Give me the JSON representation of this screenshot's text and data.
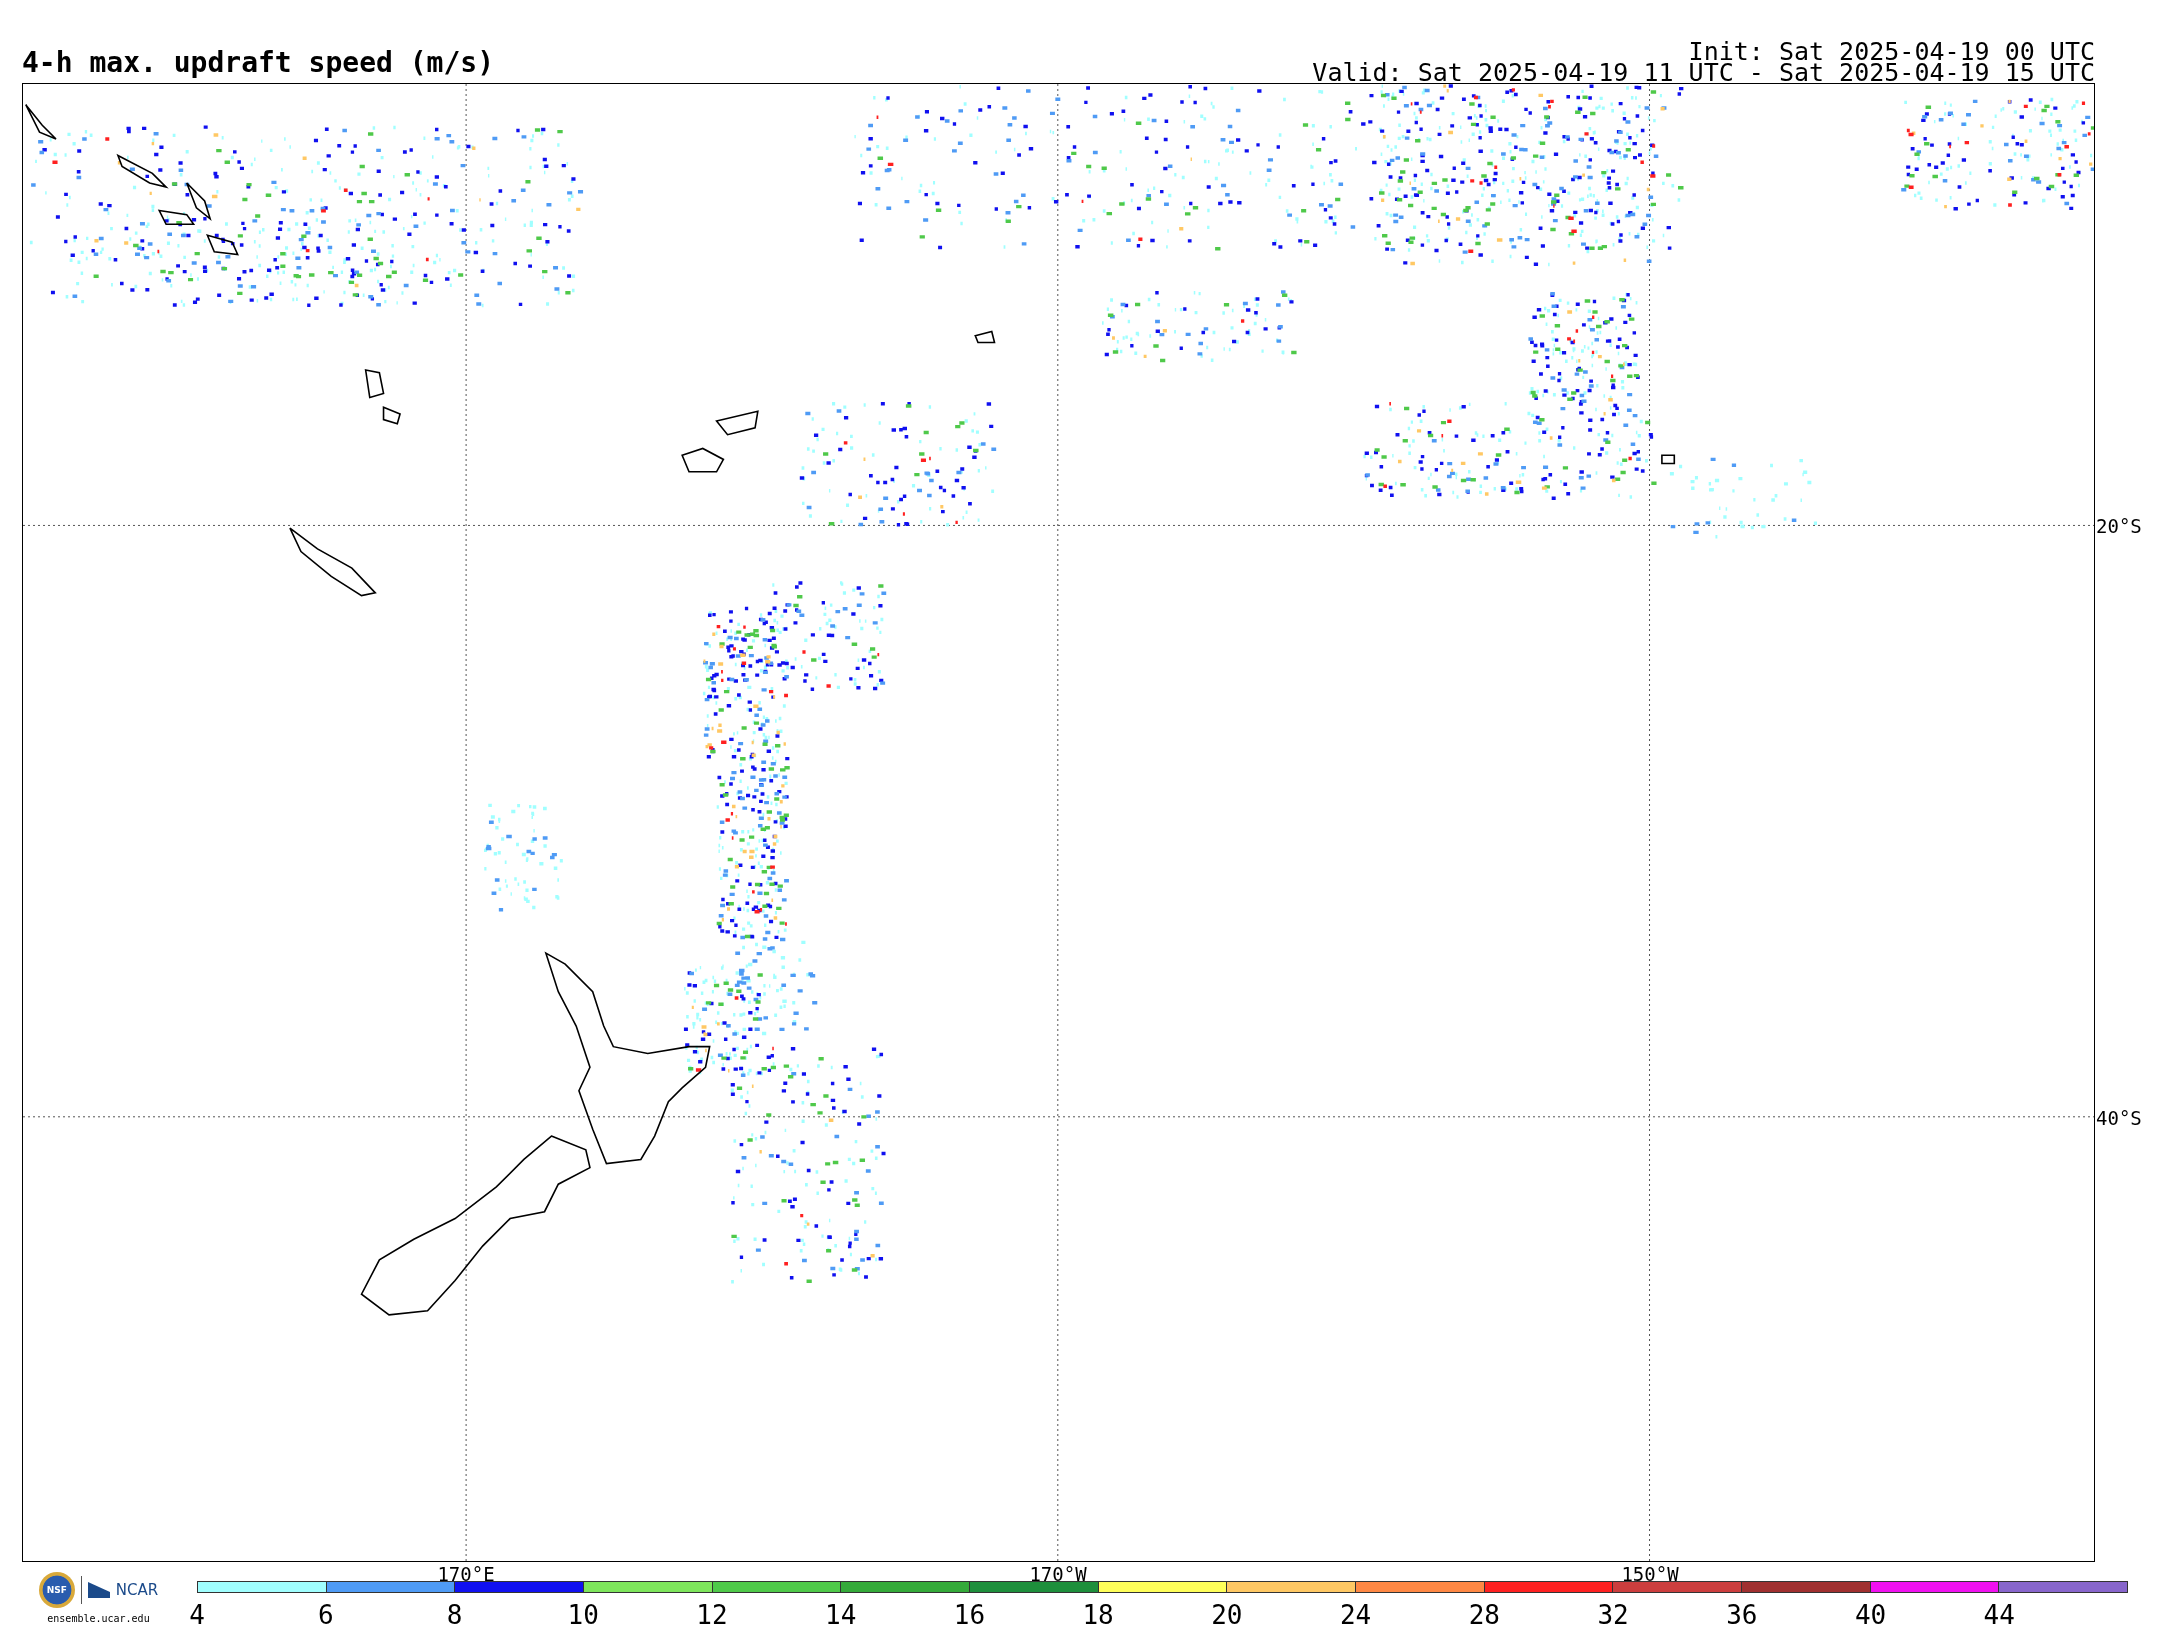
{
  "header": {
    "title": "4-h max. updraft speed (m/s)",
    "init": "Init: Sat 2025-04-19 00 UTC",
    "valid": "Valid: Sat 2025-04-19 11 UTC - Sat 2025-04-19 15 UTC"
  },
  "map": {
    "latitude_labels": [
      "20°S",
      "40°S"
    ],
    "longitude_labels": [
      "170°E",
      "170°W",
      "150°W"
    ]
  },
  "logos": {
    "emblem": "NSF",
    "brand": "NCAR",
    "url": "ensemble.ucar.edu"
  },
  "colorbar": {
    "segments": [
      {
        "color": "#a0ffff"
      },
      {
        "color": "#4f9bf5"
      },
      {
        "color": "#1010f0"
      },
      {
        "color": "#7ee55c"
      },
      {
        "color": "#4fc94a"
      },
      {
        "color": "#35aa3a"
      },
      {
        "color": "#1e8f3c"
      },
      {
        "color": "#ffff5a"
      },
      {
        "color": "#ffc864"
      },
      {
        "color": "#ff8844"
      },
      {
        "color": "#ff2020"
      },
      {
        "color": "#cc3e3e"
      },
      {
        "color": "#a03030"
      },
      {
        "color": "#f010f0"
      },
      {
        "color": "#8866cc"
      }
    ],
    "ticks": [
      "4",
      "6",
      "8",
      "10",
      "12",
      "14",
      "16",
      "18",
      "20",
      "24",
      "28",
      "32",
      "36",
      "40",
      "44"
    ]
  }
}
